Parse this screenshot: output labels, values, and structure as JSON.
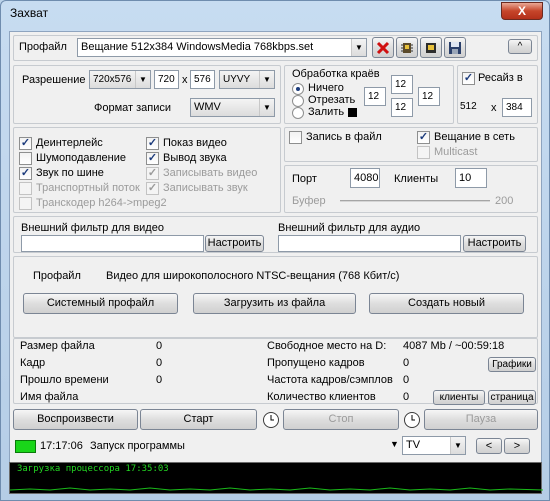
{
  "window": {
    "title": "Захват",
    "close": "X"
  },
  "profile": {
    "label": "Профайл",
    "value": "Вещание 512x384 WindowsMedia 768kbps.set",
    "collapse": "^"
  },
  "resolution": {
    "label": "Разрешение",
    "preset": "720x576",
    "width": "720",
    "x": "x",
    "height": "576",
    "colorspace": "UYVY",
    "format_label": "Формат записи",
    "format": "WMV"
  },
  "edges": {
    "title": "Обработка краёв",
    "opt_none": "Ничего",
    "opt_crop": "Отрезать",
    "opt_fill": "Залить",
    "v1": "12",
    "v2": "12",
    "v3": "12",
    "v4": "12"
  },
  "resize": {
    "label": "Ресайз в",
    "w": "512",
    "x": "x",
    "h": "384"
  },
  "options": {
    "deinterlace": "Деинтерлейс",
    "denoise": "Шумоподавление",
    "bus_audio": "Звук по шине",
    "transport": "Транспортный поток",
    "transcoder": "Транскодер h264->mpeg2",
    "show_video": "Показ видео",
    "audio_out": "Вывод звука",
    "rec_video": "Записывать видео",
    "rec_audio": "Записывать звук"
  },
  "output": {
    "rec_file": "Запись в файл",
    "broadcast": "Вещание в сеть",
    "multicast": "Multicast",
    "port_label": "Порт",
    "port": "4080",
    "clients_label": "Клиенты",
    "clients": "10",
    "buffer_label": "Буфер",
    "buffer": "200"
  },
  "filters": {
    "video_label": "Внешний фильтр для видео",
    "audio_label": "Внешний фильтр для аудио",
    "configure": "Настроить"
  },
  "profile_info": {
    "label": "Профайл",
    "desc": "Видео для широкополосного NTSC-вещания (768 Кбит/с)",
    "btn_system": "Системный профайл",
    "btn_load": "Загрузить из файла",
    "btn_new": "Создать новый"
  },
  "stats": {
    "file_size": "Размер файла",
    "file_size_v": "0",
    "frame": "Кадр",
    "frame_v": "0",
    "elapsed": "Прошло времени",
    "elapsed_v": "0",
    "file_name": "Имя файла",
    "free": "Свободное место на D:",
    "free_v": "4087 Mb / ~00:59:18",
    "dropped": "Пропущено кадров",
    "dropped_v": "0",
    "rate": "Частота кадров/сэмплов",
    "rate_v": "0",
    "clients": "Количество клиентов",
    "clients_v": "0",
    "graphs_btn": "Графики",
    "clients_btn": "клиенты",
    "page_btn": "страница"
  },
  "controls": {
    "play": "Воспроизвести",
    "start": "Старт",
    "stop": "Стоп",
    "pause": "Пауза"
  },
  "status": {
    "time": "17:17:06",
    "message": "Запуск программы",
    "tv": "TV",
    "prev": "<",
    "next": ">"
  },
  "console": {
    "text": "Загрузка процессора  17:35:03"
  }
}
